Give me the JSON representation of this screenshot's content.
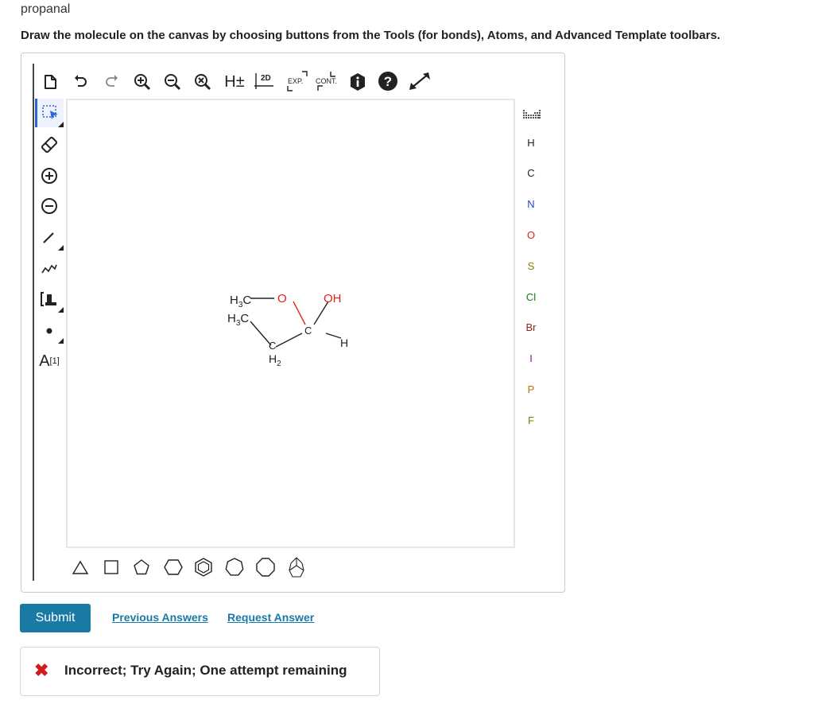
{
  "question": {
    "title": "propanal",
    "instructions": "Draw the molecule on the canvas by choosing buttons from the Tools (for bonds), Atoms, and Advanced Template toolbars."
  },
  "top_toolbar": {
    "icons": [
      "new-document",
      "undo",
      "redo",
      "zoom-in",
      "zoom-out",
      "zoom-reset",
      "add-hydrogens",
      "clean-2d",
      "expand",
      "contract",
      "info",
      "help",
      "fullscreen"
    ],
    "h_label": "H±",
    "clean_label": "2D",
    "expand_label": "EXP.",
    "contract_label": "CONT."
  },
  "left_toolbar": {
    "icons": [
      "select",
      "eraser",
      "charge-plus",
      "charge-minus",
      "single-bond",
      "chain",
      "bracket",
      "radical",
      "atom-label"
    ],
    "atom_label": "A",
    "atom_label_sup": "[1]"
  },
  "atoms": [
    "H",
    "C",
    "N",
    "O",
    "S",
    "Cl",
    "Br",
    "I",
    "P",
    "F"
  ],
  "atom_colors": {
    "H": "#222222",
    "C": "#222222",
    "N": "#2b3fb8",
    "O": "#e0201b",
    "S": "#8a7a00",
    "Cl": "#1b7a1b",
    "Br": "#8b2a1e",
    "I": "#7a1f8a",
    "P": "#c07000",
    "F": "#8a7a00"
  },
  "templates": [
    "triangle",
    "square",
    "pentagon",
    "hexagon",
    "benzene",
    "heptagon",
    "octagon",
    "bicyclic"
  ],
  "molecule": {
    "labels": {
      "h3c_top": "H",
      "h3c_top_sub": "3",
      "h3c_top_c": "C",
      "o_ether": "O",
      "oh": "OH",
      "h3c_bottom": "H",
      "h3c_bottom_sub": "3",
      "h3c_bottom_c": "C",
      "c_center": "C",
      "h_right": "H",
      "ch2_c": "C",
      "ch2_h": "H",
      "ch2_sub": "2"
    }
  },
  "actions": {
    "submit": "Submit",
    "previous_answers": "Previous Answers",
    "request_answer": "Request Answer"
  },
  "feedback": {
    "icon": "✖",
    "text": "Incorrect; Try Again; One attempt remaining"
  }
}
